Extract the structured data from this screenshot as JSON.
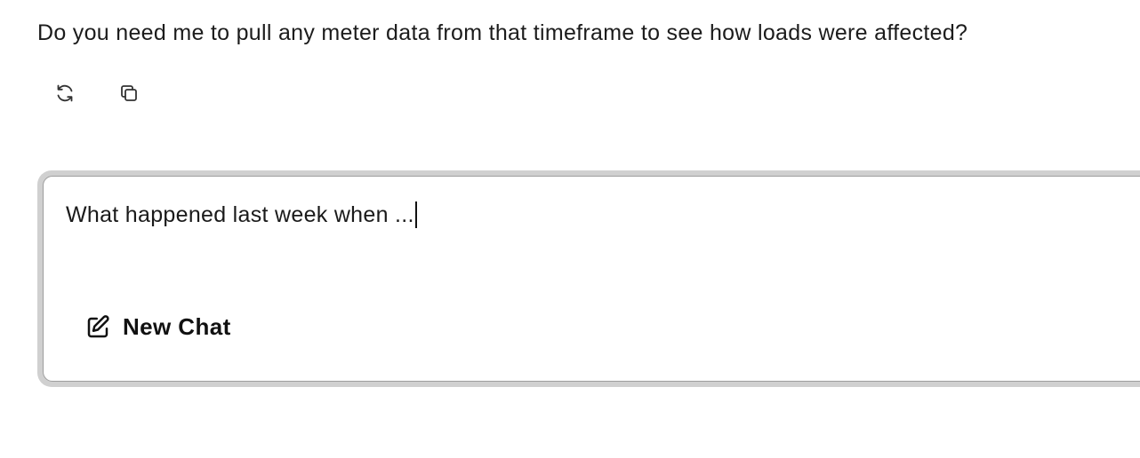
{
  "conversation": {
    "last_message": "Do you need me to pull any meter data from that timeframe to see how loads were affected?"
  },
  "message_actions": {
    "regenerate_icon": "refresh-icon",
    "copy_icon": "copy-icon"
  },
  "composer": {
    "input_value": "What happened last week when ...",
    "new_chat_label": "New Chat",
    "new_chat_icon": "edit-icon"
  }
}
